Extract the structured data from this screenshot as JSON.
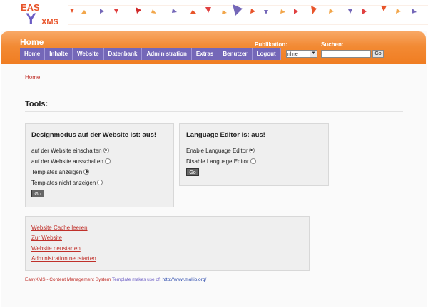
{
  "brand": {
    "logo_top": "EAS",
    "logo_mid": "Y",
    "logo_bottom": "XMS"
  },
  "header": {
    "page_title": "Home",
    "publikation_label": "Publikation:",
    "publikation_value": "nline",
    "suchen_label": "Suchen:",
    "search_value": "",
    "search_button": "Go"
  },
  "nav": [
    "Home",
    "Inhalte",
    "Website",
    "Datenbank",
    "Administration",
    "Extras",
    "Benutzer",
    "Logout"
  ],
  "breadcrumb": "Home",
  "section_title": "Tools:",
  "design_panel": {
    "title": "Designmodus auf der Website ist: aus!",
    "options": [
      "auf der Website einschalten",
      "auf der Website ausschalten",
      "Templates anzeigen",
      "Templates nicht anzeigen"
    ],
    "button": "Go"
  },
  "language_panel": {
    "title": "Language Editor is: aus!",
    "options": [
      "Enable Language Editor",
      "Disable Language Editor"
    ],
    "button": "Go"
  },
  "links": [
    "Website Cache leeren",
    "Zur Website",
    "Website neustarten",
    "Administration neustarten"
  ],
  "footer": {
    "brand_link": "EasyXMS - Content Management System",
    "text": "Template makes use of:",
    "url": "http://www.mollio.org/"
  },
  "colors": {
    "orange": "#f28a34",
    "purple_nav": "#7467b8",
    "link_red": "#c0302a"
  }
}
